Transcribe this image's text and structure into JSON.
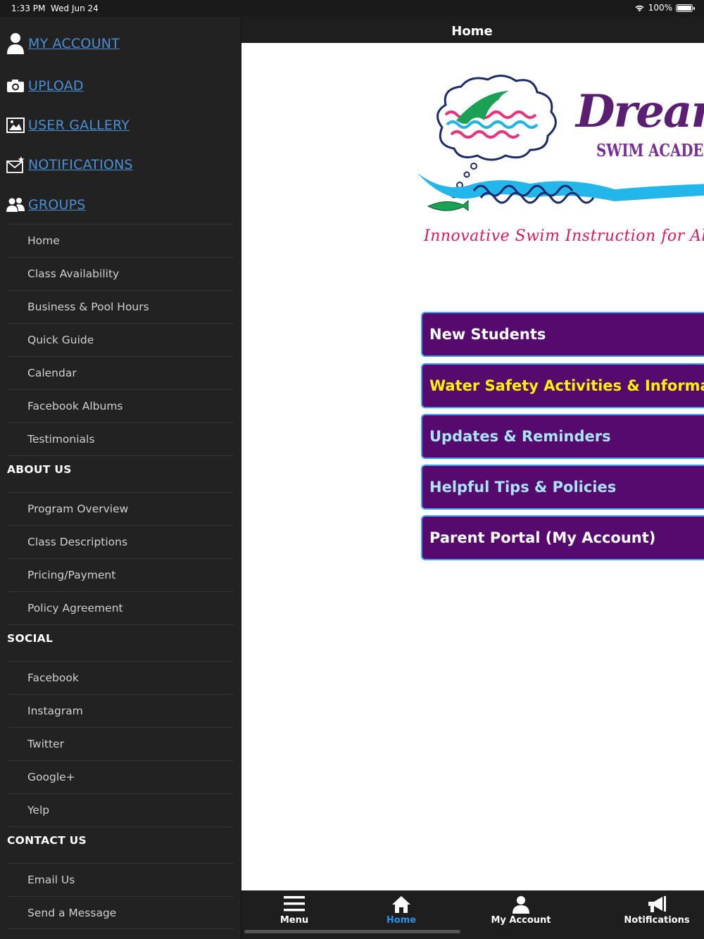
{
  "status": {
    "time": "1:33 PM",
    "date": "Wed Jun 24",
    "battery": "100%",
    "battery_level": 1.0
  },
  "sidebar": {
    "top_links": [
      {
        "label": "MY ACCOUNT",
        "icon": "user-icon"
      },
      {
        "label": "UPLOAD",
        "icon": "camera-icon"
      },
      {
        "label": "USER GALLERY",
        "icon": "image-icon"
      },
      {
        "label": "NOTIFICATIONS",
        "icon": "envelope-star-icon"
      },
      {
        "label": "GROUPS",
        "icon": "users-icon"
      }
    ],
    "groups_items": [
      "Home",
      "Class Availability",
      "Business & Pool Hours",
      "Quick Guide",
      "Calendar",
      "Facebook Albums",
      "Testimonials"
    ],
    "about_title": "ABOUT US",
    "about_items": [
      "Program Overview",
      "Class Descriptions",
      "Pricing/Payment",
      "Policy Agreement"
    ],
    "social_title": "SOCIAL",
    "social_items": [
      "Facebook",
      "Instagram",
      "Twitter",
      "Google+",
      "Yelp"
    ],
    "contact_title": "CONTACT US",
    "contact_items": [
      "Email Us",
      "Send a Message"
    ]
  },
  "header": {
    "title": "Home"
  },
  "logo": {
    "name_line1": "Dream B",
    "name_line2": "SWIM ACADEM",
    "tagline": "Innovative Swim Instruction for All Ages and Di"
  },
  "buttons": [
    {
      "label": "New Students",
      "color": "#ffffff"
    },
    {
      "label": "Water Safety Activities & Information",
      "color": "#fff200"
    },
    {
      "label": "Updates & Reminders",
      "color": "#a9e4ff"
    },
    {
      "label": "Helpful Tips & Policies",
      "color": "#a9e4ff"
    },
    {
      "label": "Parent Portal (My Account)",
      "color": "#ffffff"
    }
  ],
  "colors": {
    "button_bg": "#560a6e",
    "button_border": "#3aa2ef",
    "link": "#4a8fd6",
    "active_tab": "#2f8ee8",
    "tagline": "#d51b5d"
  },
  "tabbar": [
    {
      "label": "Menu",
      "icon": "hamburger-icon",
      "active": false
    },
    {
      "label": "Home",
      "icon": "home-icon",
      "active": true
    },
    {
      "label": "My Account",
      "icon": "user-icon",
      "active": false
    },
    {
      "label": "Notifications",
      "icon": "megaphone-icon",
      "active": false
    }
  ]
}
